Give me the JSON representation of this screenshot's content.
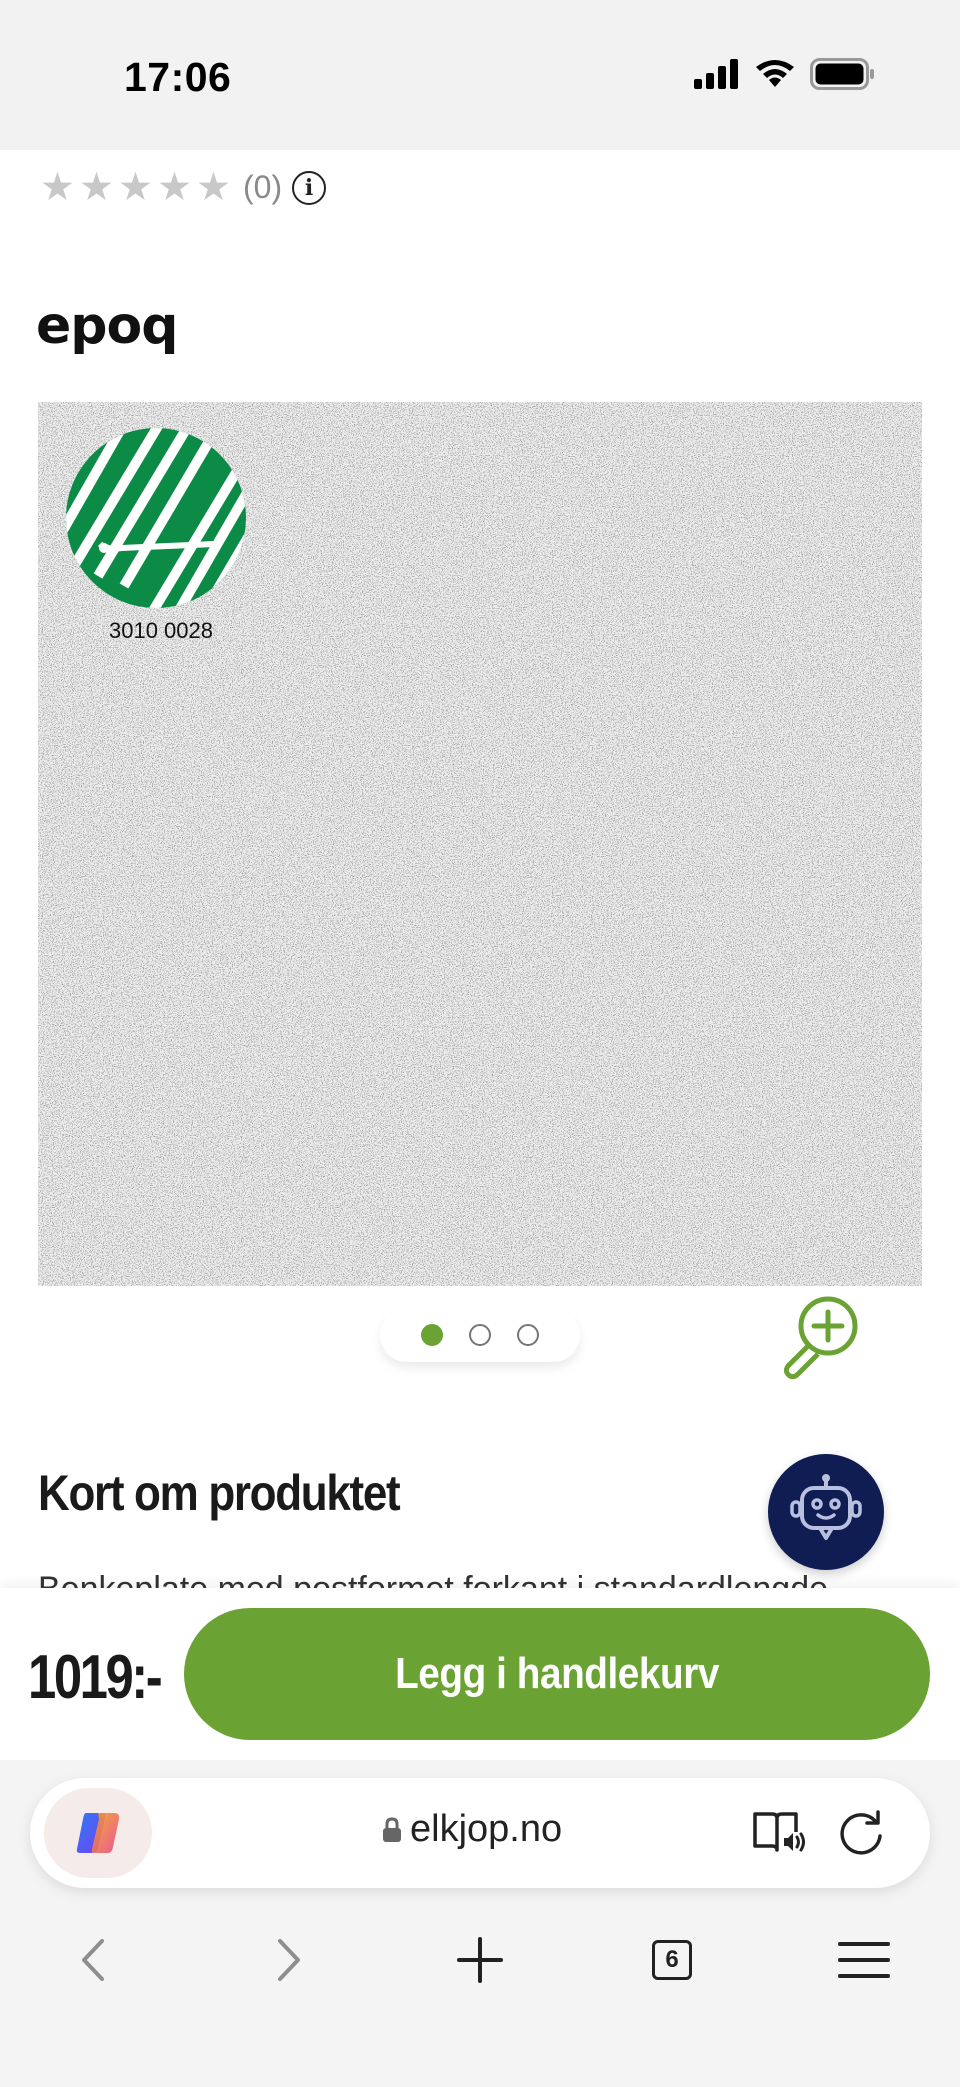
{
  "status_bar": {
    "time": "17:06"
  },
  "rating": {
    "stars_filled": 0,
    "stars_total": 5,
    "count_text": "(0)"
  },
  "brand": {
    "name": "epoq"
  },
  "product_image": {
    "ecolabel_number": "3010 0028"
  },
  "carousel": {
    "total": 3,
    "active_index": 0
  },
  "section": {
    "title": "Kort om produktet",
    "body_partial": "Benkeplate med postformet forkant i standardlengde"
  },
  "purchase": {
    "price": "1019:-",
    "cart_button_label": "Legg i handlekurv"
  },
  "browser": {
    "url": "elkjop.no",
    "tab_count": "6"
  },
  "colors": {
    "accent_green": "#6aa333",
    "chat_navy": "#0f1d52",
    "swan_green": "#0b8b45"
  }
}
